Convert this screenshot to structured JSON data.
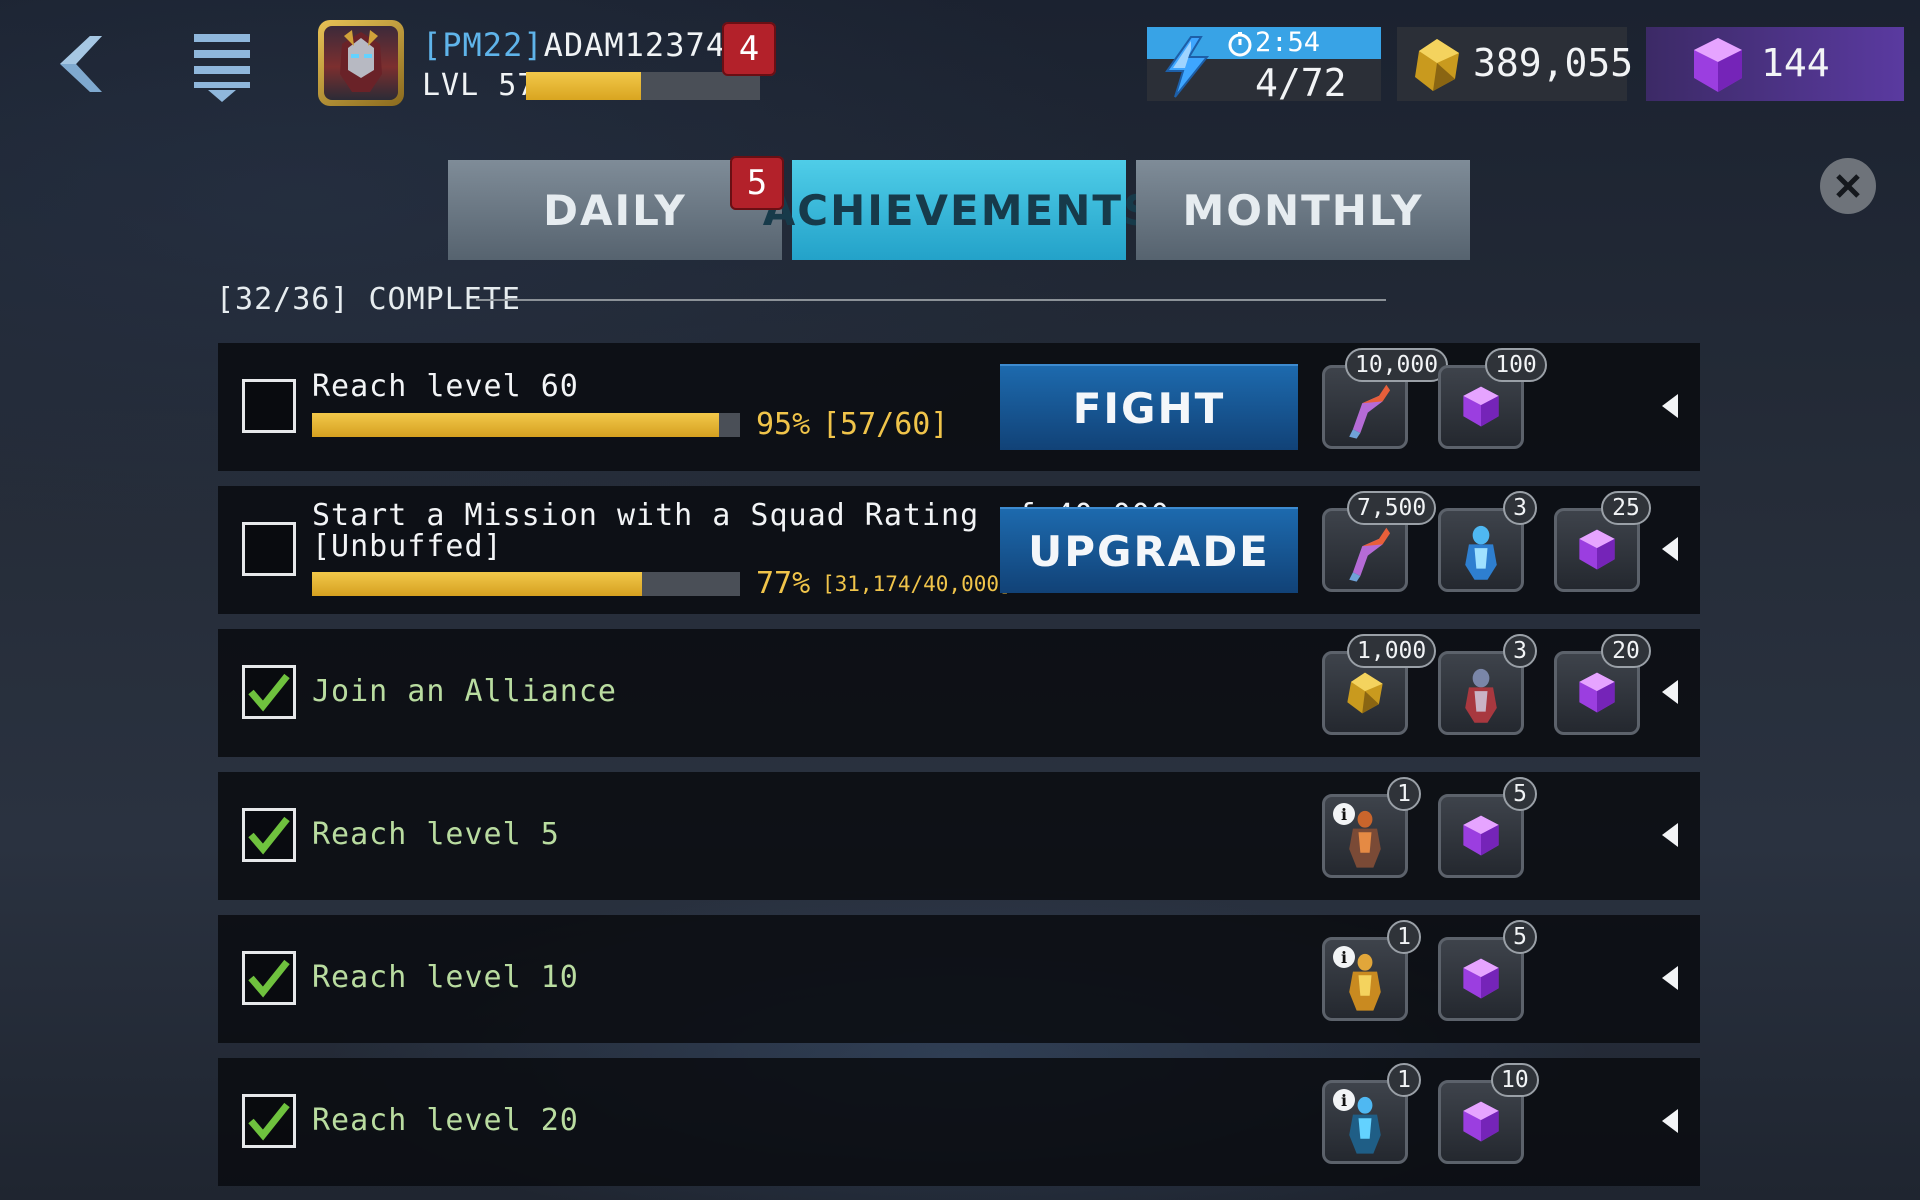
{
  "header": {
    "player_tag": "[PM22]",
    "player_name": "ADAM123744",
    "level_label": "LVL 57",
    "xp_fraction": 0.49,
    "notification_count": "4",
    "energy_timer": "2:54",
    "energy_value": "4/72",
    "gold_value": "389,055",
    "gem_value": "144"
  },
  "tabs": [
    {
      "label": "DAILY",
      "badge": "5",
      "active": false
    },
    {
      "label": "ACHIEVEMENTS",
      "active": true
    },
    {
      "label": "MONTHLY",
      "active": false
    }
  ],
  "summary": {
    "complete_label": "[32/36] COMPLETE"
  },
  "achievements": [
    {
      "title": "Reach level 60",
      "completed": false,
      "progress_fraction": 0.95,
      "progress_pct": "95%",
      "progress_ratio": "[57/60]",
      "action_label": "FIGHT",
      "rewards": [
        {
          "icon": "cyber-brush-icon",
          "count": "10,000"
        },
        {
          "icon": "purple-gem-icon",
          "count": "100"
        }
      ]
    },
    {
      "title_line1": "Start a Mission with a Squad Rating of 40,000",
      "title_line2": "[Unbuffed]",
      "completed": false,
      "progress_fraction": 0.77,
      "progress_pct": "77%",
      "progress_ratio": "[31,174/40,000]",
      "action_label": "UPGRADE",
      "rewards": [
        {
          "icon": "cyber-brush-icon",
          "count": "7,500"
        },
        {
          "icon": "blue-robot-shard-icon",
          "count": "3"
        },
        {
          "icon": "purple-gem-icon",
          "count": "25"
        }
      ]
    },
    {
      "title": "Join an Alliance",
      "completed": true,
      "rewards": [
        {
          "icon": "gold-crystal-icon",
          "count": "1,000"
        },
        {
          "icon": "red-robot-shard-icon",
          "count": "3"
        },
        {
          "icon": "purple-gem-icon",
          "count": "20"
        }
      ]
    },
    {
      "title": "Reach level 5",
      "completed": true,
      "rewards": [
        {
          "icon": "orange-robot-icon",
          "count": "1",
          "info": "i"
        },
        {
          "icon": "purple-gem-icon",
          "count": "5"
        }
      ]
    },
    {
      "title": "Reach level 10",
      "completed": true,
      "rewards": [
        {
          "icon": "yellow-robot-icon",
          "count": "1",
          "info": "i"
        },
        {
          "icon": "purple-gem-icon",
          "count": "5"
        }
      ]
    },
    {
      "title": "Reach level 20",
      "completed": true,
      "rewards": [
        {
          "icon": "cyan-robot-icon",
          "count": "1",
          "info": "i"
        },
        {
          "icon": "purple-gem-icon",
          "count": "10"
        }
      ]
    }
  ],
  "colors": {
    "active_tab": "#2fb6d9",
    "progress": "#e2b030",
    "action_button": "#175a98",
    "badge_red": "#b3212a",
    "completed_text": "#b9dca0"
  }
}
